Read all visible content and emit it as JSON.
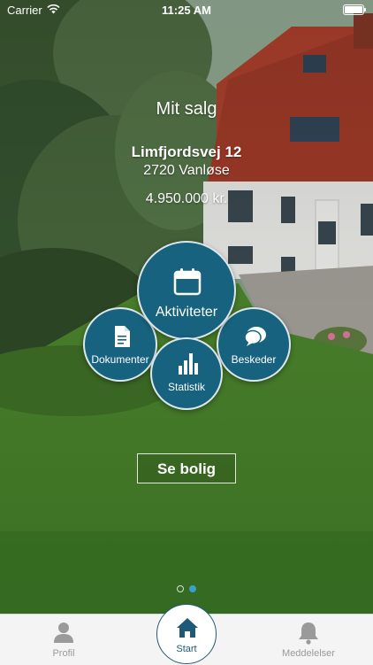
{
  "status_bar": {
    "carrier": "Carrier",
    "time": "11:25 AM"
  },
  "sale": {
    "title": "Mit salg",
    "address": "Limfjordsvej 12",
    "city": "2720 Vanløse",
    "price": "4.950.000 kr."
  },
  "actions": {
    "aktiviteter": {
      "label": "Aktiviteter",
      "icon": "calendar-icon"
    },
    "dokumenter": {
      "label": "Dokumenter",
      "icon": "document-icon"
    },
    "statistik": {
      "label": "Statistik",
      "icon": "bar-chart-icon"
    },
    "beskeder": {
      "label": "Beskeder",
      "icon": "chat-bubble-icon"
    }
  },
  "see_button": {
    "label": "Se bolig"
  },
  "pager": {
    "pages": 2,
    "current": 2
  },
  "tabbar": {
    "profil": {
      "label": "Profil",
      "icon": "person-icon"
    },
    "start": {
      "label": "Start",
      "icon": "home-icon"
    },
    "meddelelser": {
      "label": "Meddelelser",
      "icon": "bell-icon"
    }
  },
  "colors": {
    "accent": "#17627f",
    "tab_active": "#1e5a77",
    "tab_inactive": "#9a9a9a",
    "page_dot_active": "#3aa0c8"
  }
}
